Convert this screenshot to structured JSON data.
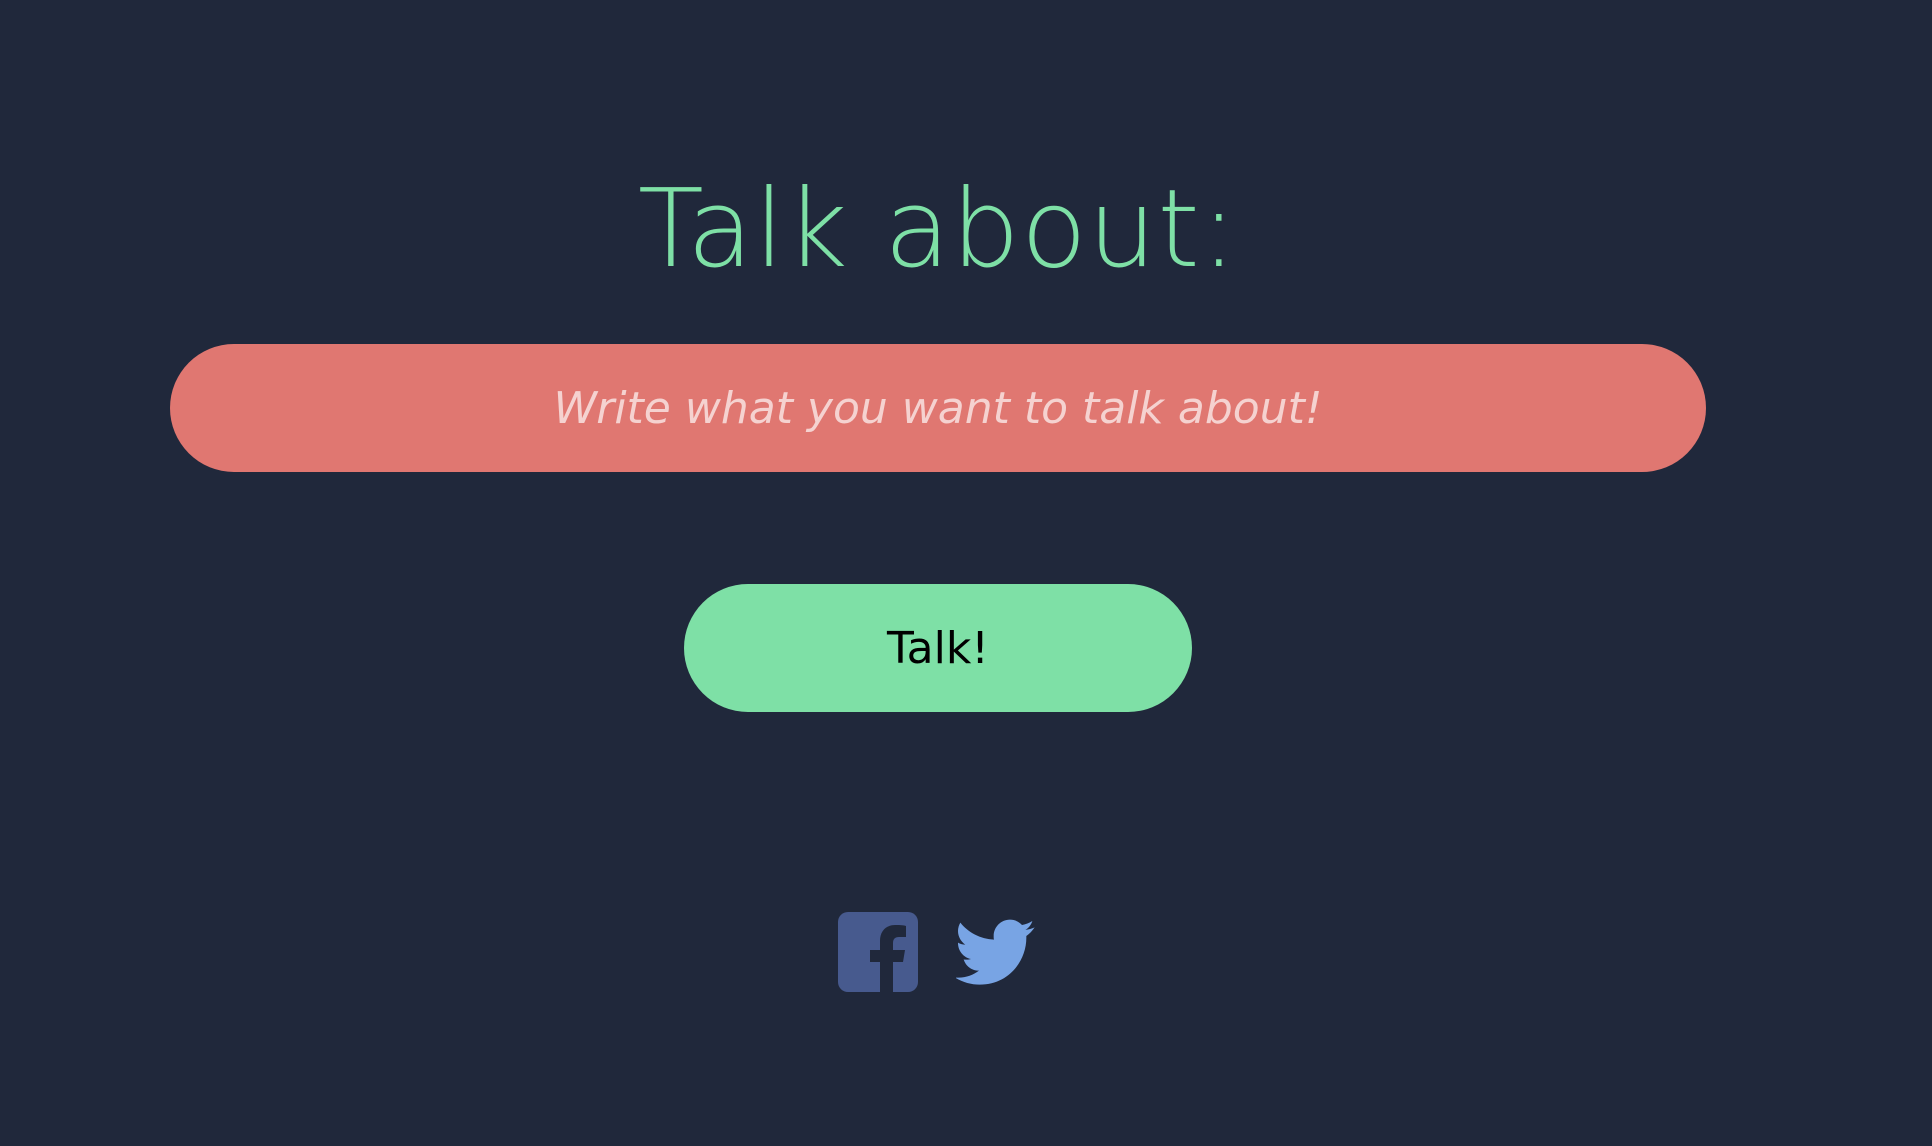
{
  "header": {
    "title": "Talk about:"
  },
  "topic": {
    "placeholder": "Write what you want to talk about!",
    "value": ""
  },
  "actions": {
    "talk_label": "Talk!"
  },
  "social": {
    "items": [
      {
        "icon": "facebook-icon",
        "color": "#475a8e"
      },
      {
        "icon": "twitter-icon",
        "color": "#78a4e4"
      }
    ]
  },
  "colors": {
    "background": "#20283b",
    "accent": "#7ee0a6",
    "input_background": "#e07771"
  }
}
